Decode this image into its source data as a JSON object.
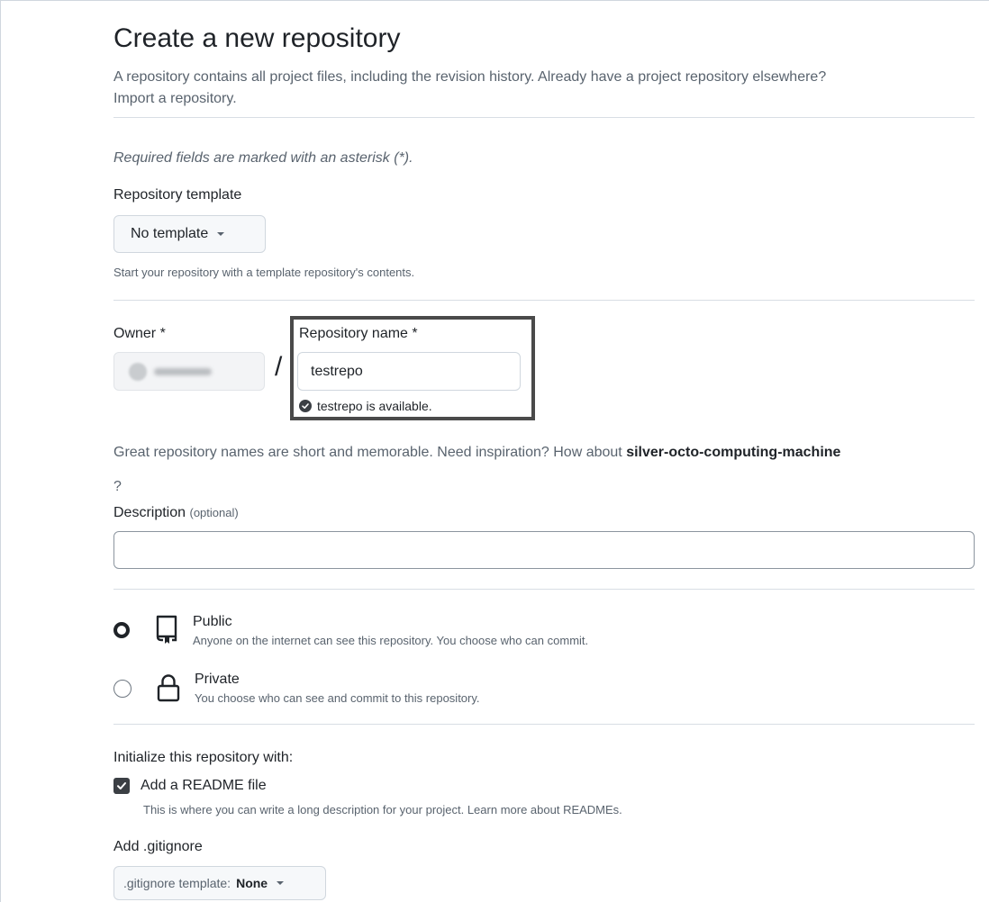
{
  "page": {
    "title": "Create a new repository",
    "intro_text": "A repository contains all project files, including the revision history. Already have a project repository elsewhere?",
    "import_link": "Import a repository.",
    "required_note": "Required fields are marked with an asterisk (*)."
  },
  "template": {
    "label": "Repository template",
    "selected": "No template",
    "hint": "Start your repository with a template repository's contents."
  },
  "owner": {
    "label": "Owner *"
  },
  "repository_name": {
    "label": "Repository name *",
    "value": "testrepo",
    "availability": "testrepo is available."
  },
  "suggestion": {
    "text": "Great repository names are short and memorable. Need inspiration? How about",
    "suggested_name": "silver-octo-computing-machine",
    "trailing": "?"
  },
  "description": {
    "label": "Description",
    "optional": "(optional)",
    "value": ""
  },
  "visibility": {
    "options": [
      {
        "title": "Public",
        "description": "Anyone on the internet can see this repository. You choose who can commit.",
        "selected": true,
        "icon": "repo-icon"
      },
      {
        "title": "Private",
        "description": "You choose who can see and commit to this repository.",
        "selected": false,
        "icon": "lock-icon"
      }
    ]
  },
  "initialize": {
    "heading": "Initialize this repository with:",
    "readme_label": "Add a README file",
    "readme_checked": true,
    "readme_description": "This is where you can write a long description for your project. Learn more about READMEs."
  },
  "gitignore": {
    "label": "Add .gitignore",
    "select_prefix": ".gitignore template:",
    "select_value": "None"
  }
}
